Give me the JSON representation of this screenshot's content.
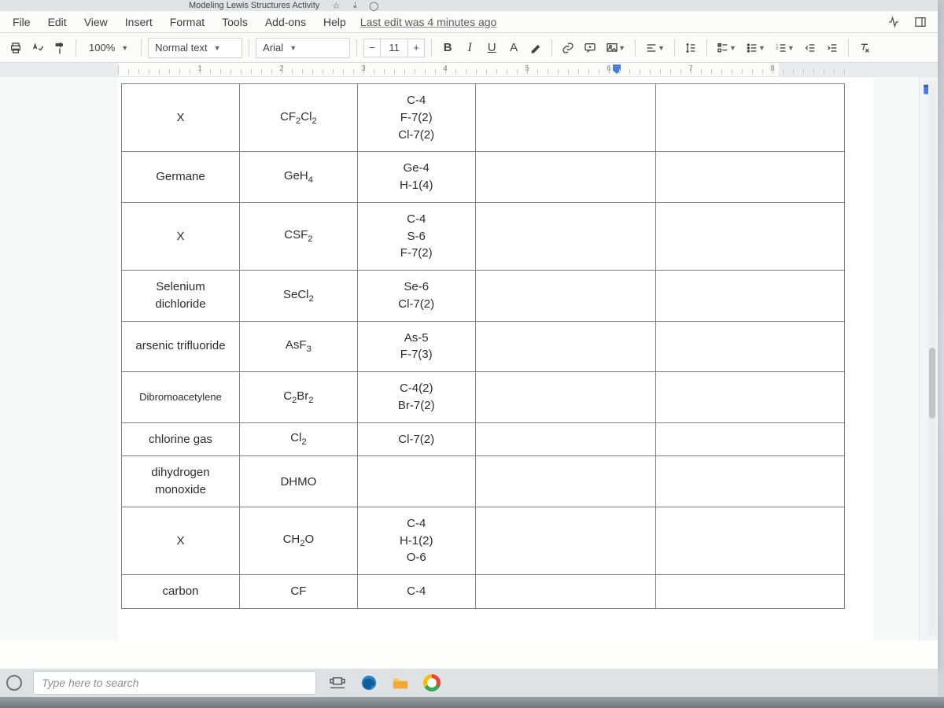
{
  "browser": {
    "tab_title_fragment": "Modeling Lewis Structures Activity"
  },
  "menubar": {
    "items": [
      "File",
      "Edit",
      "View",
      "Insert",
      "Format",
      "Tools",
      "Add-ons",
      "Help"
    ],
    "last_edit": "Last edit was 4 minutes ago"
  },
  "toolbar": {
    "zoom": "100%",
    "style": "Normal text",
    "font": "Arial",
    "font_size": "11",
    "bold": "B",
    "italic": "I",
    "underline": "U",
    "textcolor": "A"
  },
  "ruler": {
    "numbers": [
      "1",
      "2",
      "3",
      "4",
      "5",
      "6",
      "7",
      "8"
    ]
  },
  "table": {
    "rows": [
      {
        "name": "X",
        "formula_html": "CF<span class='sub'>2</span>Cl<span class='sub'>2</span>",
        "notes_html": "C-4<br>F-7(2)<br>Cl-7(2)"
      },
      {
        "name": "Germane",
        "formula_html": "GeH<span class='sub'>4</span>",
        "notes_html": "Ge-4<br>H-1(4)"
      },
      {
        "name": "X",
        "formula_html": "CSF<span class='sub'>2</span>",
        "notes_html": "C-4<br>S-6<br>F-7(2)"
      },
      {
        "name": "Selenium dichloride",
        "formula_html": "SeCl<span class='sub'>2</span>",
        "notes_html": "Se-6<br>Cl-7(2)"
      },
      {
        "name": "arsenic trifluoride",
        "formula_html": "AsF<span class='sub'>3</span>",
        "notes_html": "As-5<br>F-7(3)"
      },
      {
        "name_html": "<span class='small'>Dibromoacetylene</span>",
        "formula_html": "C<span class='sub'>2</span>Br<span class='sub'>2</span>",
        "notes_html": "C-4(2)<br>Br-7(2)"
      },
      {
        "name": "chlorine gas",
        "formula_html": "Cl<span class='sub'>2</span>",
        "notes_html": "Cl-7(2)"
      },
      {
        "name": "dihydrogen monoxide",
        "formula_html": "DHMO",
        "notes_html": ""
      },
      {
        "name": "X",
        "formula_html": "CH<span class='sub'>2</span>O",
        "notes_html": "C-4<br>H-1(2)<br>O-6"
      },
      {
        "name": "carbon",
        "formula_html": "CF",
        "notes_html": "C-4"
      }
    ]
  },
  "taskbar": {
    "search_placeholder": "Type here to search"
  }
}
